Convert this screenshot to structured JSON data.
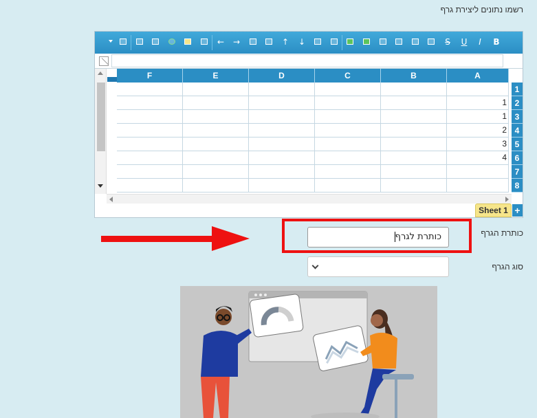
{
  "page": {
    "heading": "רשמו נתונים ליצירת גרף",
    "background_color": "#d7ecf2",
    "accent_color": "#2b8ec4",
    "highlight_color": "#ee1111"
  },
  "spreadsheet": {
    "toolbar_icons": [
      "chart-icon",
      "fit-icon",
      "bank-icon",
      "recycle-icon",
      "note-icon",
      "clear-format-icon",
      "arrow-left-icon",
      "arrow-right-icon",
      "sort-asc-icon",
      "sort-desc-icon",
      "arrow-up-icon",
      "arrow-down-icon",
      "columns-icon",
      "rows-icon",
      "table-icon",
      "table-alt-icon",
      "align-top-icon",
      "align-right-icon",
      "align-center-icon",
      "align-left-icon",
      "strikethrough-icon",
      "underline-icon",
      "italic-icon",
      "bold-icon"
    ],
    "toolbar_glyphs": {
      "strikethrough-icon": "S",
      "underline-icon": "U",
      "italic-icon": "I",
      "bold-icon": "B",
      "arrow-left-icon": "←",
      "arrow-right-icon": "→",
      "arrow-up-icon": "↑",
      "arrow-down-icon": "↓"
    },
    "columns": [
      "F",
      "E",
      "D",
      "C",
      "B",
      "A"
    ],
    "rows": [
      "1",
      "2",
      "3",
      "4",
      "5",
      "6",
      "7",
      "8"
    ],
    "cells": [
      [
        "",
        "",
        "",
        "",
        "",
        ""
      ],
      [
        "",
        "",
        "",
        "",
        "",
        "1"
      ],
      [
        "",
        "",
        "",
        "",
        "",
        "1"
      ],
      [
        "",
        "",
        "",
        "",
        "",
        "2"
      ],
      [
        "",
        "",
        "",
        "",
        "",
        "3"
      ],
      [
        "",
        "",
        "",
        "",
        "",
        "4"
      ],
      [
        "",
        "",
        "",
        "",
        "",
        ""
      ],
      [
        "",
        "",
        "",
        "",
        "",
        ""
      ]
    ],
    "sheet_tab": "Sheet 1",
    "add_sheet": "+"
  },
  "form": {
    "title_label": "כותרת הגרף",
    "title_value": "כותרת לגרף",
    "type_label": "סוג הגרף",
    "type_value": ""
  }
}
